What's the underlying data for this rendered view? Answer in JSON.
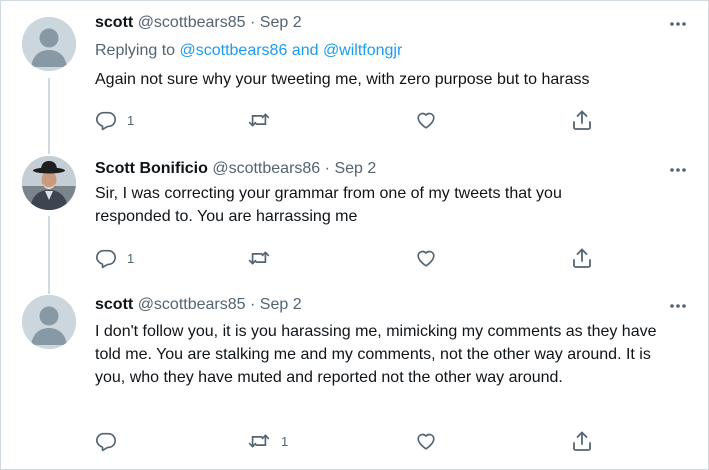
{
  "tweets": [
    {
      "name": "scott",
      "handle": "@scottbears85",
      "separator": "·",
      "date": "Sep 2",
      "reply_prefix": "Replying to",
      "reply_users": "@scottbears86 and @wiltfongjr",
      "text": "Again not sure why your tweeting me, with zero purpose but to harass",
      "reply_count": "1",
      "retweet_count": "",
      "avatar": "default-profile"
    },
    {
      "name": "Scott Bonificio",
      "handle": "@scottbears86",
      "separator": "·",
      "date": "Sep 2",
      "text": "Sir, I was correcting your grammar from one of my tweets that you responded to. You are harrassing me",
      "reply_count": "1",
      "retweet_count": "",
      "avatar": "photo"
    },
    {
      "name": "scott",
      "handle": "@scottbears85",
      "separator": "·",
      "date": "Sep 2",
      "text": "I don't follow you, it is you harassing me, mimicking my comments as they have told me. You are stalking me and my comments, not the other way around. It is you, who they have muted and reported not the other way around.",
      "reply_count": "",
      "retweet_count": "1",
      "avatar": "default-profile"
    }
  ],
  "icons": {
    "reply": "reply-icon",
    "retweet": "retweet-icon",
    "like": "like-icon",
    "share": "share-icon",
    "more": "more-icon"
  },
  "colors": {
    "link": "#1d9bf0",
    "muted": "#536471",
    "text": "#0f1419",
    "line": "#cfd9de"
  }
}
